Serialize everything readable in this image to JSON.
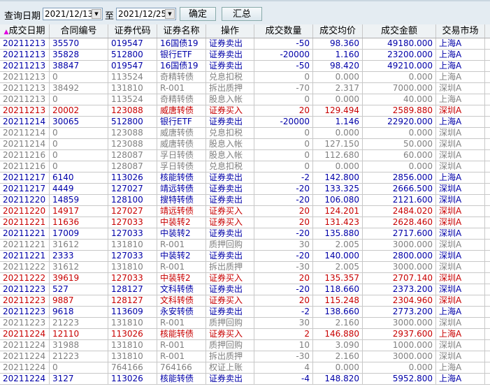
{
  "toolbar": {
    "query_label": "查询日期",
    "from_date": "2021/12/13",
    "to_label": "至",
    "to_date": "2021/12/25",
    "confirm_label": "确定",
    "summary_label": "汇总"
  },
  "columns": [
    "成交日期",
    "合同编号",
    "证券代码",
    "证券名称",
    "操作",
    "成交数量",
    "成交均价",
    "成交金额",
    "交易市场"
  ],
  "colors": {
    "sell": "#0000a8",
    "buy": "#c80000",
    "other": "#808080"
  },
  "rows": [
    {
      "t": "blue",
      "c": [
        "20211213",
        "35570",
        "019547",
        "16国债19",
        "证券卖出",
        "-50",
        "98.360",
        "49180.000",
        "上海A"
      ]
    },
    {
      "t": "blue",
      "c": [
        "20211213",
        "35828",
        "512800",
        "银行ETF",
        "证券卖出",
        "-20000",
        "1.160",
        "23200.000",
        "上海A"
      ]
    },
    {
      "t": "blue",
      "c": [
        "20211213",
        "38847",
        "019547",
        "16国债19",
        "证券卖出",
        "-50",
        "98.420",
        "49210.000",
        "上海A"
      ]
    },
    {
      "t": "gray",
      "c": [
        "20211213",
        "0",
        "113524",
        "奇精转债",
        "兑息扣税",
        "0",
        "0.000",
        "0.000",
        "上海A"
      ]
    },
    {
      "t": "gray",
      "c": [
        "20211213",
        "38492",
        "131810",
        "R-001",
        "拆出质押",
        "-70",
        "2.317",
        "7000.000",
        "深圳A"
      ]
    },
    {
      "t": "gray",
      "c": [
        "20211213",
        "0",
        "113524",
        "奇精转债",
        "股息入帐",
        "0",
        "0.000",
        "40.000",
        "上海A"
      ]
    },
    {
      "t": "red",
      "c": [
        "20211213",
        "20002",
        "123088",
        "威唐转债",
        "证券买入",
        "20",
        "129.494",
        "2589.880",
        "深圳A"
      ]
    },
    {
      "t": "blue",
      "c": [
        "20211214",
        "30065",
        "512800",
        "银行ETF",
        "证券卖出",
        "-20000",
        "1.146",
        "22920.000",
        "上海A"
      ]
    },
    {
      "t": "gray",
      "c": [
        "20211214",
        "0",
        "123088",
        "威唐转债",
        "兑息扣税",
        "0",
        "0.000",
        "0.000",
        "深圳A"
      ]
    },
    {
      "t": "gray",
      "c": [
        "20211214",
        "0",
        "123088",
        "威唐转债",
        "股息入帐",
        "0",
        "127.150",
        "50.000",
        "深圳A"
      ]
    },
    {
      "t": "gray",
      "c": [
        "20211216",
        "0",
        "128087",
        "孚日转债",
        "股息入帐",
        "0",
        "112.680",
        "60.000",
        "深圳A"
      ]
    },
    {
      "t": "gray",
      "c": [
        "20211216",
        "0",
        "128087",
        "孚日转债",
        "兑息扣税",
        "0",
        "0.000",
        "0.000",
        "深圳A"
      ]
    },
    {
      "t": "blue",
      "c": [
        "20211217",
        "6140",
        "113026",
        "核能转债",
        "证券卖出",
        "-2",
        "142.800",
        "2856.000",
        "上海A"
      ]
    },
    {
      "t": "blue",
      "c": [
        "20211217",
        "4449",
        "127027",
        "靖远转债",
        "证券卖出",
        "-20",
        "133.325",
        "2666.500",
        "深圳A"
      ]
    },
    {
      "t": "blue",
      "c": [
        "20211220",
        "14859",
        "128100",
        "搜特转债",
        "证券卖出",
        "-20",
        "106.080",
        "2121.600",
        "深圳A"
      ]
    },
    {
      "t": "red",
      "c": [
        "20211220",
        "14917",
        "127027",
        "靖远转债",
        "证券买入",
        "20",
        "124.201",
        "2484.020",
        "深圳A"
      ]
    },
    {
      "t": "red",
      "c": [
        "20211221",
        "11636",
        "127033",
        "中装转2",
        "证券买入",
        "20",
        "131.423",
        "2628.460",
        "深圳A"
      ]
    },
    {
      "t": "blue",
      "c": [
        "20211221",
        "17009",
        "127033",
        "中装转2",
        "证券卖出",
        "-20",
        "135.880",
        "2717.600",
        "深圳A"
      ]
    },
    {
      "t": "gray",
      "c": [
        "20211221",
        "31612",
        "131810",
        "R-001",
        "质押回购",
        "30",
        "2.005",
        "3000.000",
        "深圳A"
      ]
    },
    {
      "t": "blue",
      "c": [
        "20211221",
        "2333",
        "127033",
        "中装转2",
        "证券卖出",
        "-20",
        "140.000",
        "2800.000",
        "深圳A"
      ]
    },
    {
      "t": "gray",
      "c": [
        "20211222",
        "31612",
        "131810",
        "R-001",
        "拆出质押",
        "-30",
        "2.005",
        "3000.000",
        "深圳A"
      ]
    },
    {
      "t": "red",
      "c": [
        "20211222",
        "39619",
        "127033",
        "中装转2",
        "证券买入",
        "20",
        "135.357",
        "2707.140",
        "深圳A"
      ]
    },
    {
      "t": "blue",
      "c": [
        "20211223",
        "527",
        "128127",
        "文科转债",
        "证券卖出",
        "-20",
        "118.660",
        "2373.200",
        "深圳A"
      ]
    },
    {
      "t": "red",
      "c": [
        "20211223",
        "9887",
        "128127",
        "文科转债",
        "证券买入",
        "20",
        "115.248",
        "2304.960",
        "深圳A"
      ]
    },
    {
      "t": "blue",
      "c": [
        "20211223",
        "9618",
        "113609",
        "永安转债",
        "证券卖出",
        "-2",
        "138.660",
        "2773.200",
        "上海A"
      ]
    },
    {
      "t": "gray",
      "c": [
        "20211223",
        "21223",
        "131810",
        "R-001",
        "质押回购",
        "30",
        "2.160",
        "3000.000",
        "深圳A"
      ]
    },
    {
      "t": "red",
      "c": [
        "20211224",
        "12110",
        "113026",
        "核能转债",
        "证券买入",
        "2",
        "146.880",
        "2937.600",
        "上海A"
      ]
    },
    {
      "t": "gray",
      "c": [
        "20211224",
        "31988",
        "131810",
        "R-001",
        "质押回购",
        "10",
        "3.090",
        "1000.000",
        "深圳A"
      ]
    },
    {
      "t": "gray",
      "c": [
        "20211224",
        "21223",
        "131810",
        "R-001",
        "拆出质押",
        "-30",
        "2.160",
        "3000.000",
        "深圳A"
      ]
    },
    {
      "t": "gray",
      "c": [
        "20211224",
        "0",
        "764166",
        "764166",
        "权证上账",
        "4",
        "0.000",
        "0.000",
        "上海A"
      ]
    },
    {
      "t": "blue",
      "c": [
        "20211224",
        "3127",
        "113026",
        "核能转债",
        "证券卖出",
        "-4",
        "148.820",
        "5952.800",
        "上海A"
      ]
    }
  ]
}
